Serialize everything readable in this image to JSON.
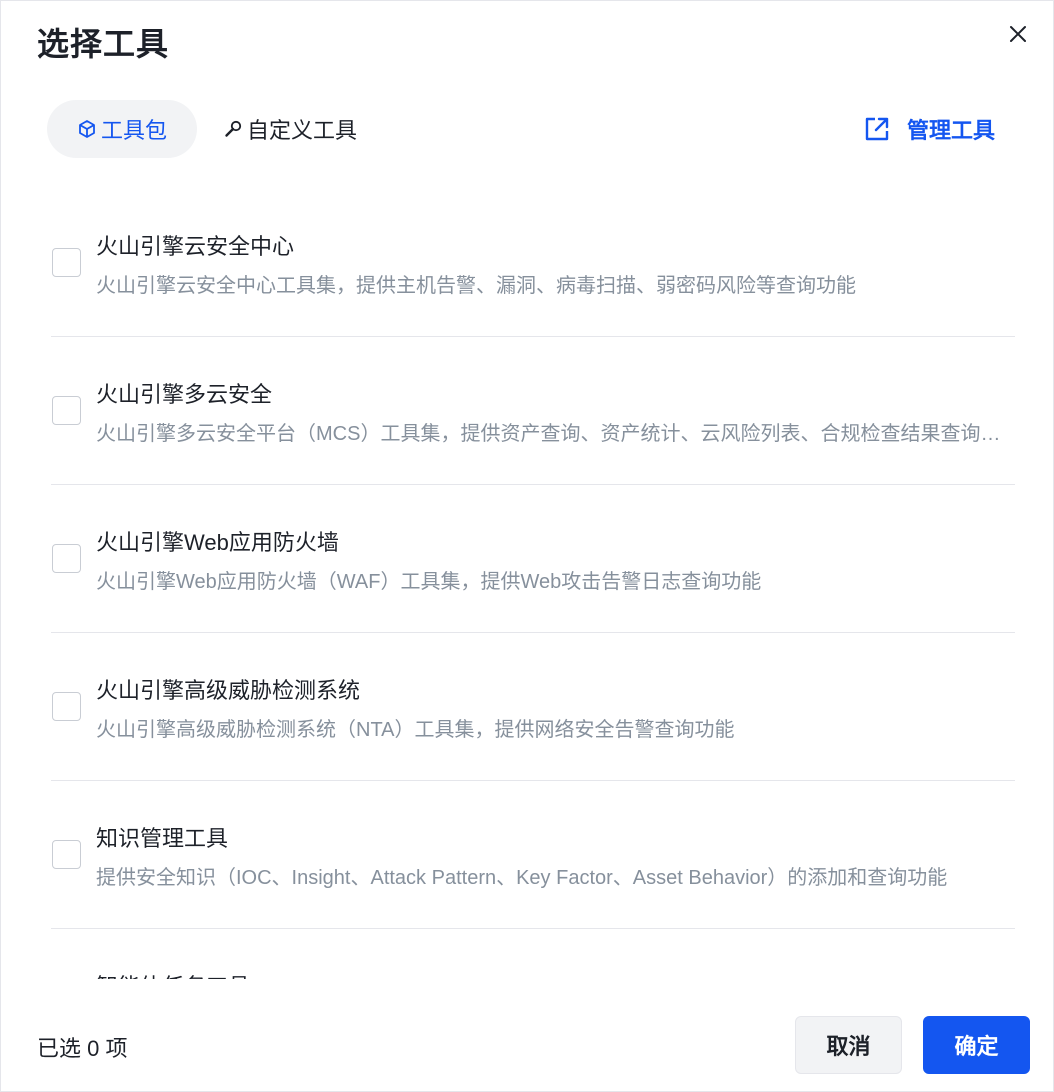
{
  "dialog": {
    "title": "选择工具"
  },
  "tabs": [
    {
      "label": "工具包",
      "icon": "cube-icon",
      "active": true
    },
    {
      "label": "自定义工具",
      "icon": "wrench-icon",
      "active": false
    }
  ],
  "manage_link": {
    "label": "管理工具",
    "icon": "external-link-icon"
  },
  "tools": [
    {
      "name": "火山引擎云安全中心",
      "description": "火山引擎云安全中心工具集，提供主机告警、漏洞、病毒扫描、弱密码风险等查询功能",
      "checked": false
    },
    {
      "name": "火山引擎多云安全",
      "description": "火山引擎多云安全平台（MCS）工具集，提供资产查询、资产统计、云风险列表、合规检查结果查询等功能",
      "checked": false
    },
    {
      "name": "火山引擎Web应用防火墙",
      "description": "火山引擎Web应用防火墙（WAF）工具集，提供Web攻击告警日志查询功能",
      "checked": false
    },
    {
      "name": "火山引擎高级威胁检测系统",
      "description": "火山引擎高级威胁检测系统（NTA）工具集，提供网络安全告警查询功能",
      "checked": false
    },
    {
      "name": "知识管理工具",
      "description": "提供安全知识（IOC、Insight、Attack Pattern、Key Factor、Asset Behavior）的添加和查询功能",
      "checked": false
    },
    {
      "name": "智能体任务工具",
      "description": "",
      "checked": false
    }
  ],
  "footer": {
    "selected_text": "已选 0 项",
    "cancel_label": "取消",
    "confirm_label": "确定"
  },
  "colors": {
    "primary": "#1456f0",
    "text": "#1d2129",
    "secondary_text": "#86909c",
    "border": "#e5e6eb",
    "tab_bg": "#f2f3f5"
  }
}
